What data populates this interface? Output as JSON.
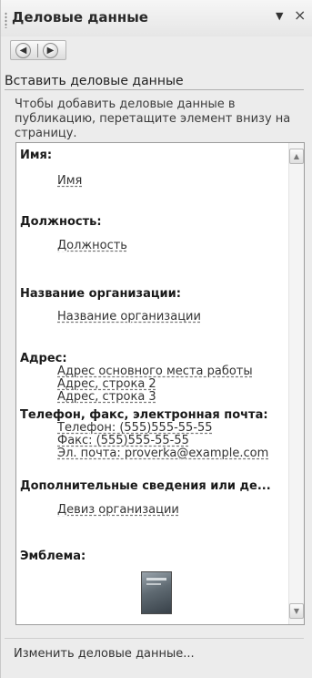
{
  "pane": {
    "title": "Деловые данные",
    "menu_icon": "▼",
    "close_icon": "×"
  },
  "nav": {
    "back_icon": "◀",
    "forward_icon": "▶"
  },
  "section": {
    "header": "Вставить деловые данные",
    "instruction": "Чтобы добавить деловые данные в публикацию, перетащите элемент внизу на страницу."
  },
  "fields": {
    "name": {
      "label": "Имя:",
      "value": "Имя"
    },
    "position": {
      "label": "Должность:",
      "value": "Должность"
    },
    "organization": {
      "label": "Название организации:",
      "value": "Название организации"
    },
    "address": {
      "label": "Адрес:",
      "line1": "Адрес основного места работы",
      "line2": "Адрес, строка 2",
      "line3": "Адрес, строка 3"
    },
    "contacts": {
      "label": "Телефон, факс, электронная почта:",
      "phone": "Телефон: (555)555-55-55",
      "fax": "Факс: (555)555-55-55",
      "email": "Эл. почта: proverka@example.com"
    },
    "extra": {
      "label": "Дополнительные сведения или де...",
      "value": "Девиз организации"
    },
    "logo": {
      "label": "Эмблема:"
    }
  },
  "footer": {
    "change_link": "Изменить деловые данные..."
  },
  "colors": {
    "pane_background": "#ececec",
    "list_background": "#ffffff"
  }
}
